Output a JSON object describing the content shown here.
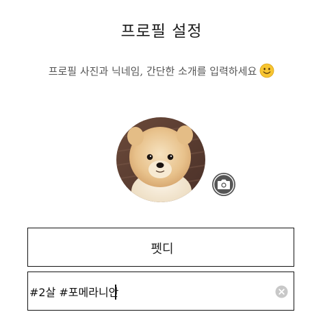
{
  "header": {
    "title": "프로필 설정",
    "subtitle": "프로필 사진과 닉네임, 간단한 소개를 입력하세요"
  },
  "profile": {
    "avatar_icon": "pomeranian-photo",
    "camera_icon": "camera-icon"
  },
  "form": {
    "nickname_value": "펫디",
    "intro_value": "#2살 #포메라니안",
    "clear_icon": "clear-icon"
  },
  "colors": {
    "border": "#111111",
    "camera_bg": "#555555",
    "clear_bg": "#c8c8c8",
    "emoji": "#f7c531"
  }
}
